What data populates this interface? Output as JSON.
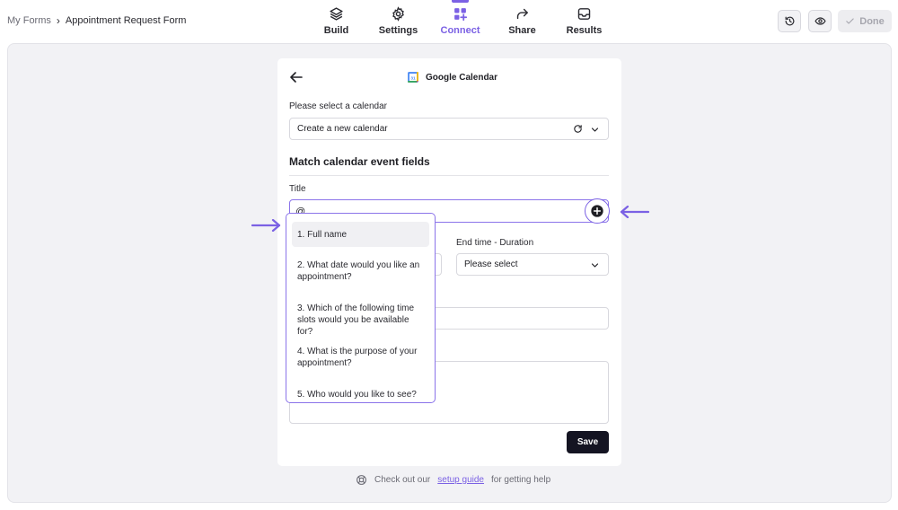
{
  "breadcrumb": {
    "root": "My Forms",
    "separator": "›",
    "current": "Appointment Request Form"
  },
  "nav": [
    {
      "label": "Build",
      "icon": "layers-icon",
      "active": false
    },
    {
      "label": "Settings",
      "icon": "gear-icon",
      "active": false
    },
    {
      "label": "Connect",
      "icon": "grid-plus-icon",
      "active": true
    },
    {
      "label": "Share",
      "icon": "share-arrow-icon",
      "active": false
    },
    {
      "label": "Results",
      "icon": "inbox-icon",
      "active": false
    }
  ],
  "toolbar": {
    "history_icon": "history-icon",
    "preview_icon": "eye-icon",
    "done_label": "Done"
  },
  "integration": {
    "name": "Google Calendar",
    "icon": "google-calendar-icon"
  },
  "calendar": {
    "label": "Please select a calendar",
    "value": "Create a new calendar"
  },
  "section_title": "Match calendar event fields",
  "title_field": {
    "label": "Title",
    "value": "@"
  },
  "end_time": {
    "label": "End time - Duration",
    "value": "Please select"
  },
  "dropdown": {
    "items": [
      "1. Full name",
      "2. What date would you like an appointment?",
      "3. Which of the following time slots would you be available for?",
      "4. What is the purpose of your appointment?",
      "5. Who would you like to see?"
    ]
  },
  "save_label": "Save",
  "footer": {
    "prefix": "Check out our",
    "link": "setup guide",
    "suffix": "for getting help"
  },
  "colors": {
    "accent": "#7b61e4",
    "save_bg": "#141422",
    "canvas_bg": "#f2f2f5"
  }
}
